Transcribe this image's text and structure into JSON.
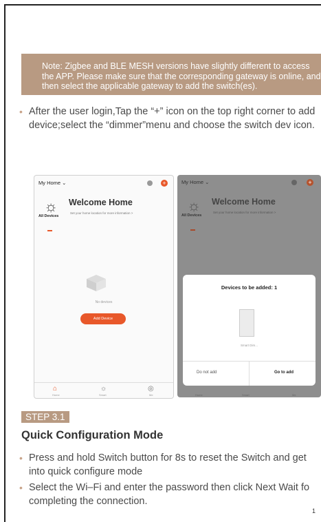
{
  "note_text": "Note: Zigbee and BLE MESH versions have slightly different to access the APP. Please make sure that the corresponding gateway is online, and then select the applicable gateway to add the switch(es).",
  "instruction": "After the user login,Tap the “+” icon on the top right corner to add device;select the “dimmer”menu and choose the switch dev icon.",
  "phone1": {
    "home_label": "My Home ⌄",
    "welcome": "Welcome Home",
    "subtitle": "Set your home location for more information >",
    "all_devices": "All Devices",
    "no_devices": "No devices",
    "add_device": "Add Device",
    "tabs": [
      "Home",
      "Smart",
      "Me"
    ]
  },
  "phone2": {
    "home_label": "My Home ⌄",
    "welcome": "Welcome Home",
    "subtitle": "Set your home location for more information >",
    "all_devices": "All Devices",
    "dialog_title": "Devices to be added: 1",
    "device_label": "Smart Dim...",
    "do_not_add": "Do not add",
    "go_to_add": "Go to add",
    "tabs": [
      "Home",
      "Smart",
      "Me"
    ]
  },
  "step_label": "STEP 3.1",
  "section_title": "Quick Configuration Mode",
  "bullets": [
    "Press and hold Switch button for 8s to reset the Switch and get into quick configure mode",
    "Select the Wi–Fi and enter the password then click Next Wait fo completing the connection."
  ],
  "page_number": "1",
  "colors": {
    "accent": "#b89a82",
    "orange": "#e8582a"
  }
}
